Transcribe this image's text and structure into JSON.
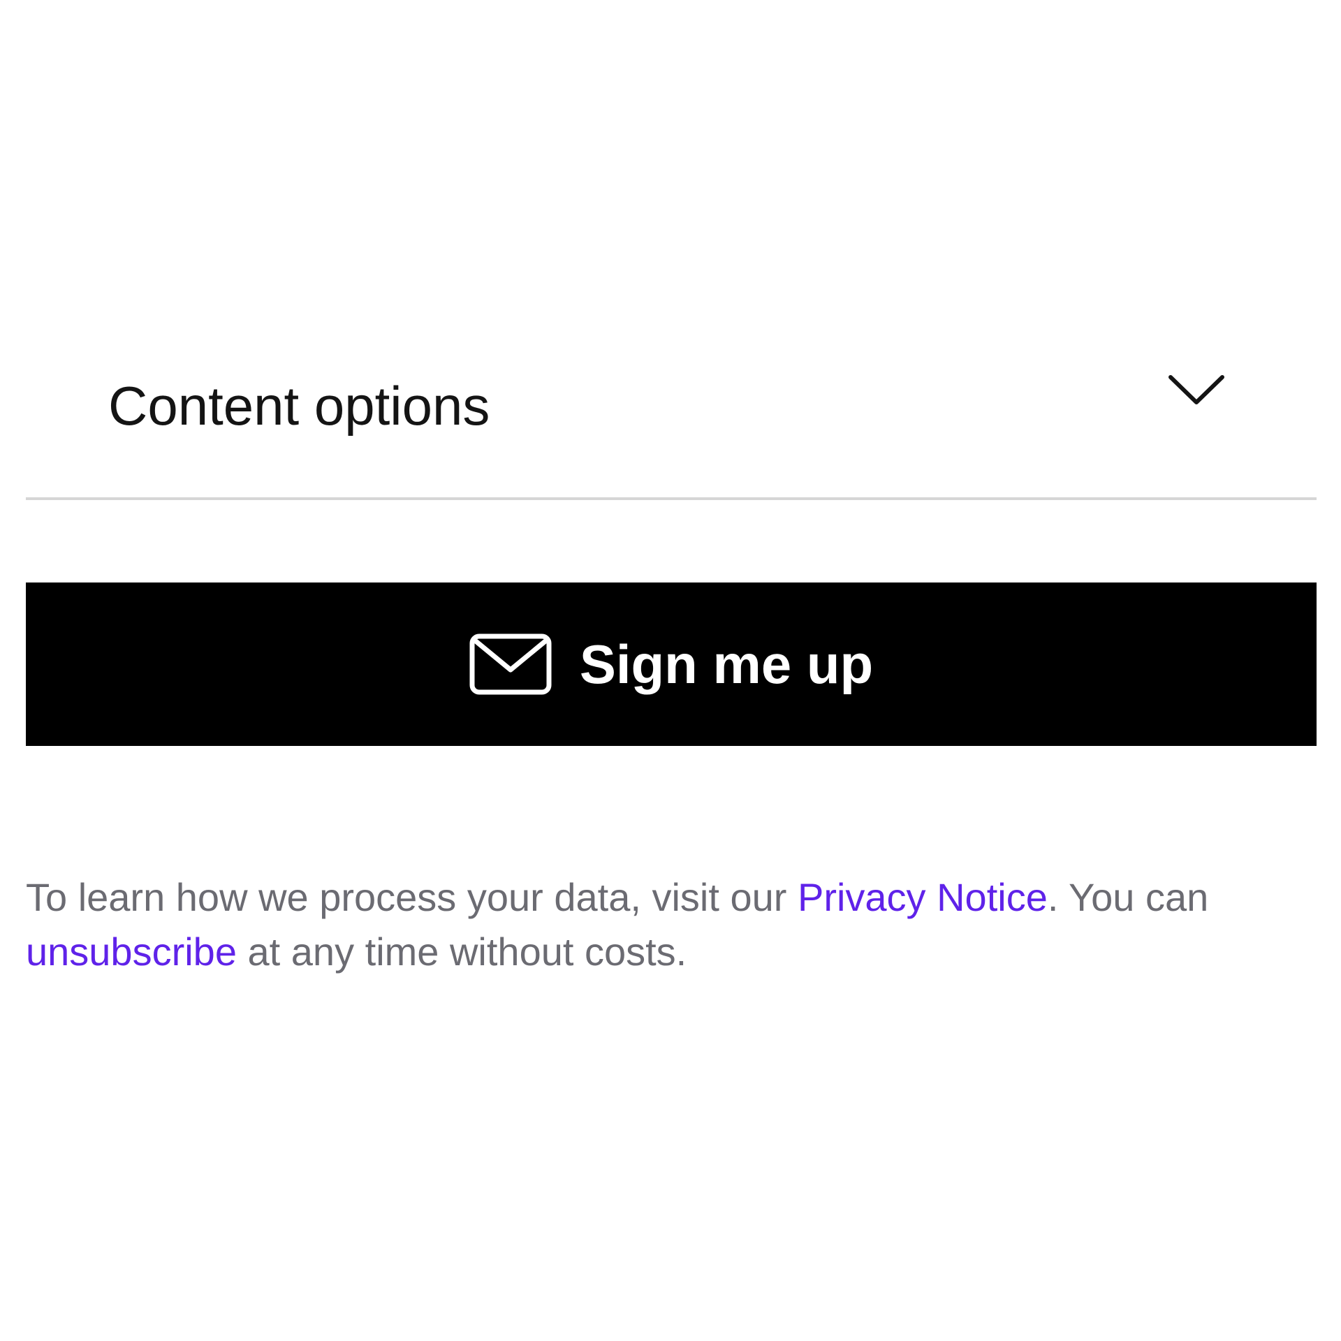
{
  "accordion": {
    "label": "Content options",
    "icon": "chevron-down-icon",
    "expanded": false
  },
  "signup_button": {
    "icon": "mail-icon",
    "label": "Sign me up",
    "background": "#000000",
    "text_color": "#ffffff"
  },
  "disclaimer": {
    "part1": "To learn how we process your data, visit our ",
    "privacy_link": "Privacy Notice",
    "part2": ". You can ",
    "unsubscribe_link": "unsubscribe",
    "part3": " at any time without costs.",
    "text_color": "#6b6b72",
    "link_color": "#5f22e9"
  }
}
